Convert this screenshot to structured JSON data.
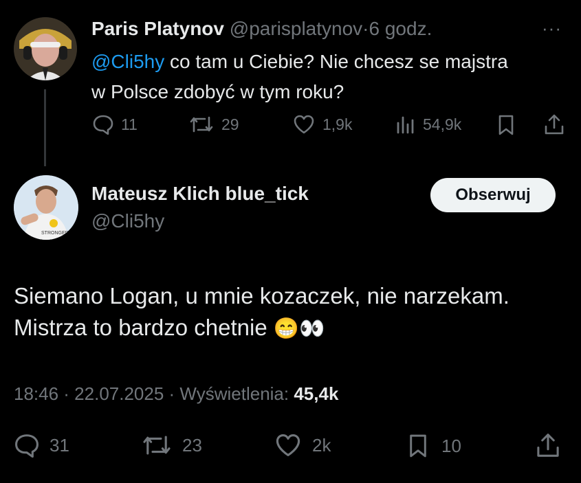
{
  "parent_tweet": {
    "author_name": "Paris Platynov",
    "handle": "@parisplatynov",
    "dot": "·",
    "time": "6 godz.",
    "more": "···",
    "mention": "@Cli5hy",
    "text_after_mention": " co tam u Ciebie? Nie chcesz se majstra",
    "text_line2": "w Polsce zdobyć w tym roku?",
    "stats": {
      "replies": "11",
      "retweets": "29",
      "likes": "1,9k",
      "views": "54,9k"
    }
  },
  "reply_tweet": {
    "author_name": "Mateusz Klich blue_tick",
    "handle": "@Cli5hy",
    "follow_label": "Obserwuj",
    "text_line1": "Siemano Logan, u mnie kozaczek, nie narzekam.",
    "text_line2": "Mistrza to bardzo chetnie",
    "emojis": "😁👀",
    "timestamp": "18:46 · 22.07.2025 · ",
    "views_label": "Wyświetlenia: ",
    "views_value": "45,4k",
    "stats": {
      "replies": "31",
      "retweets": "23",
      "likes": "2k",
      "bookmarks": "10"
    }
  },
  "colors": {
    "accent": "#1d9bf0",
    "muted": "#71767b",
    "text": "#e7e9ea",
    "background": "#000000"
  }
}
